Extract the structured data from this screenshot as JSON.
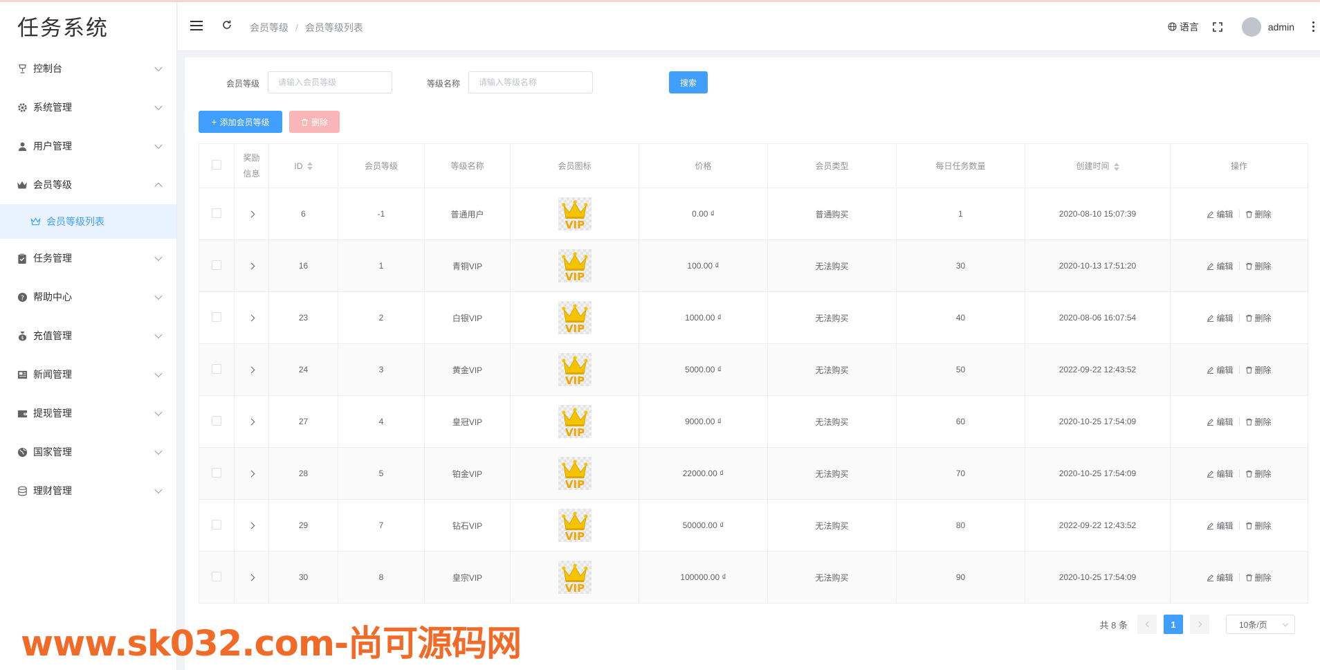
{
  "app": {
    "title": "任务系统"
  },
  "sidebar": {
    "items": [
      {
        "label": "控制台",
        "icon": "trophy-icon",
        "expanded": false
      },
      {
        "label": "系统管理",
        "icon": "gear-icon",
        "expanded": false
      },
      {
        "label": "用户管理",
        "icon": "user-icon",
        "expanded": false
      },
      {
        "label": "会员等级",
        "icon": "crown-icon",
        "expanded": true
      },
      {
        "label": "任务管理",
        "icon": "clipboard-icon",
        "expanded": false
      },
      {
        "label": "帮助中心",
        "icon": "question-icon",
        "expanded": false
      },
      {
        "label": "充值管理",
        "icon": "money-bag-icon",
        "expanded": false
      },
      {
        "label": "新闻管理",
        "icon": "news-icon",
        "expanded": false
      },
      {
        "label": "提现管理",
        "icon": "wallet-icon",
        "expanded": false
      },
      {
        "label": "国家管理",
        "icon": "globe-icon",
        "expanded": false
      },
      {
        "label": "理财管理",
        "icon": "database-icon",
        "expanded": false
      }
    ],
    "subitem": {
      "label": "会员等级列表",
      "icon": "crown-outline-icon"
    }
  },
  "header": {
    "breadcrumb": [
      "会员等级",
      "会员等级列表"
    ],
    "language": "语言",
    "username": "admin"
  },
  "search": {
    "level_label": "会员等级",
    "level_placeholder": "请输入会员等级",
    "name_label": "等级名称",
    "name_placeholder": "请输入等级名称",
    "search_button": "搜索"
  },
  "toolbar": {
    "add_label": "添加会员等级",
    "delete_label": "删除"
  },
  "table": {
    "columns": [
      "奖励信息",
      "ID",
      "会员等级",
      "等级名称",
      "会员图标",
      "价格",
      "会员类型",
      "每日任务数量",
      "创建时间",
      "操作"
    ],
    "rows": [
      {
        "id": "6",
        "level": "-1",
        "name": "普通用户",
        "price": "0.00 ₫",
        "type": "普通购买",
        "tasks": "1",
        "created": "2020-08-10 15:07:39"
      },
      {
        "id": "16",
        "level": "1",
        "name": "青铜VIP",
        "price": "100.00 ₫",
        "type": "无法购买",
        "tasks": "30",
        "created": "2020-10-13 17:51:20"
      },
      {
        "id": "23",
        "level": "2",
        "name": "白银VIP",
        "price": "1000.00 ₫",
        "type": "无法购买",
        "tasks": "40",
        "created": "2020-08-06 16:07:54"
      },
      {
        "id": "24",
        "level": "3",
        "name": "黄金VIP",
        "price": "5000.00 ₫",
        "type": "无法购买",
        "tasks": "50",
        "created": "2022-09-22 12:43:52"
      },
      {
        "id": "27",
        "level": "4",
        "name": "皇冠VIP",
        "price": "9000.00 ₫",
        "type": "无法购买",
        "tasks": "60",
        "created": "2020-10-25 17:54:09"
      },
      {
        "id": "28",
        "level": "5",
        "name": "铂金VIP",
        "price": "22000.00 ₫",
        "type": "无法购买",
        "tasks": "70",
        "created": "2020-10-25 17:54:09"
      },
      {
        "id": "29",
        "level": "7",
        "name": "钻石VIP",
        "price": "50000.00 ₫",
        "type": "无法购买",
        "tasks": "80",
        "created": "2022-09-22 12:43:52"
      },
      {
        "id": "30",
        "level": "8",
        "name": "皇宗VIP",
        "price": "100000.00 ₫",
        "type": "无法购买",
        "tasks": "90",
        "created": "2020-10-25 17:54:09"
      }
    ],
    "edit_label": "编辑",
    "delete_label": "删除",
    "icon_text": "VIP"
  },
  "pagination": {
    "total": "共 8 条",
    "current": "1",
    "page_size": "10条/页"
  },
  "watermark": "www.sk032.com-尚可源码网",
  "colors": {
    "primary": "#409eff",
    "danger_disabled": "#fab6b6",
    "watermark": "#f26a28",
    "crown": "#f5c400"
  }
}
